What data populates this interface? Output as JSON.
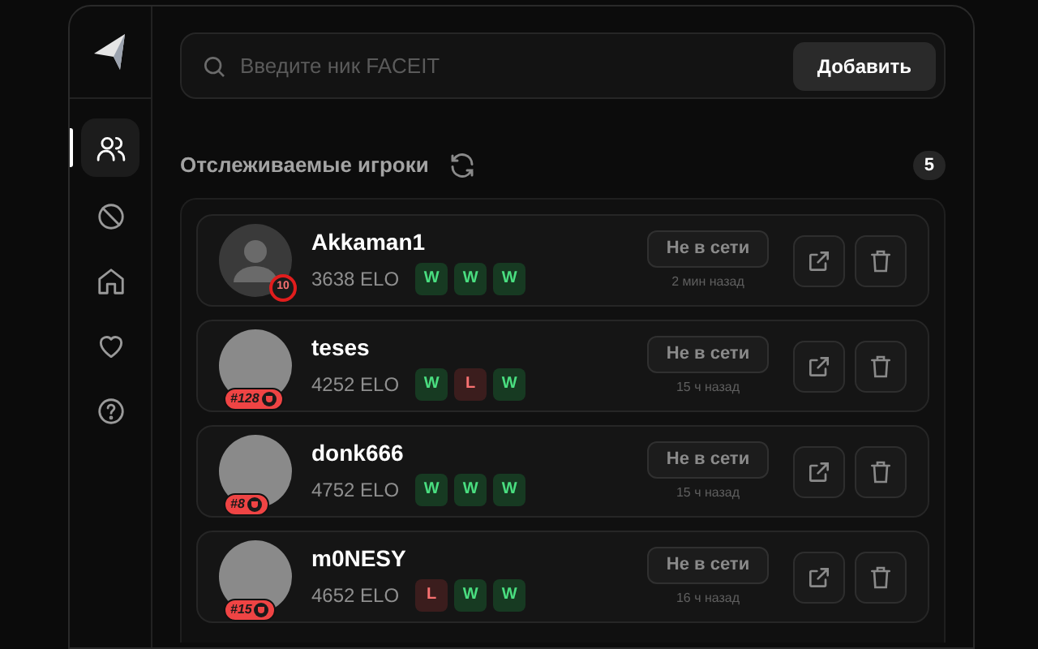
{
  "sidebar": {
    "items": [
      {
        "selected": true
      },
      {
        "selected": false
      },
      {
        "selected": false
      },
      {
        "selected": false
      },
      {
        "selected": false
      }
    ]
  },
  "search": {
    "placeholder": "Введите ник FACEIT",
    "button": "Добавить"
  },
  "header": {
    "title": "Отслеживаемые игроки",
    "count": "5"
  },
  "players": [
    {
      "name": "Akkaman1",
      "elo": "3638 ELO",
      "kind": "silhouette",
      "badge": {
        "kind": "level",
        "text": "10"
      },
      "results": [
        {
          "kind": "win",
          "text": "W"
        },
        {
          "kind": "win",
          "text": "W"
        },
        {
          "kind": "win",
          "text": "W"
        }
      ],
      "status": "Не в сети",
      "last_seen": "2 мин назад"
    },
    {
      "name": "teses",
      "elo": "4252 ELO",
      "kind": "photo",
      "badge": {
        "kind": "rank",
        "text": "#128"
      },
      "results": [
        {
          "kind": "win",
          "text": "W"
        },
        {
          "kind": "loss",
          "text": "L"
        },
        {
          "kind": "win",
          "text": "W"
        }
      ],
      "status": "Не в сети",
      "last_seen": "15 ч назад"
    },
    {
      "name": "donk666",
      "elo": "4752 ELO",
      "kind": "photo",
      "badge": {
        "kind": "rank",
        "text": "#8"
      },
      "results": [
        {
          "kind": "win",
          "text": "W"
        },
        {
          "kind": "win",
          "text": "W"
        },
        {
          "kind": "win",
          "text": "W"
        }
      ],
      "status": "Не в сети",
      "last_seen": "15 ч назад"
    },
    {
      "name": "m0NESY",
      "elo": "4652 ELO",
      "kind": "photo",
      "badge": {
        "kind": "rank",
        "text": "#15"
      },
      "results": [
        {
          "kind": "loss",
          "text": "L"
        },
        {
          "kind": "win",
          "text": "W"
        },
        {
          "kind": "win",
          "text": "W"
        }
      ],
      "status": "Не в сети",
      "last_seen": "16 ч назад"
    }
  ]
}
